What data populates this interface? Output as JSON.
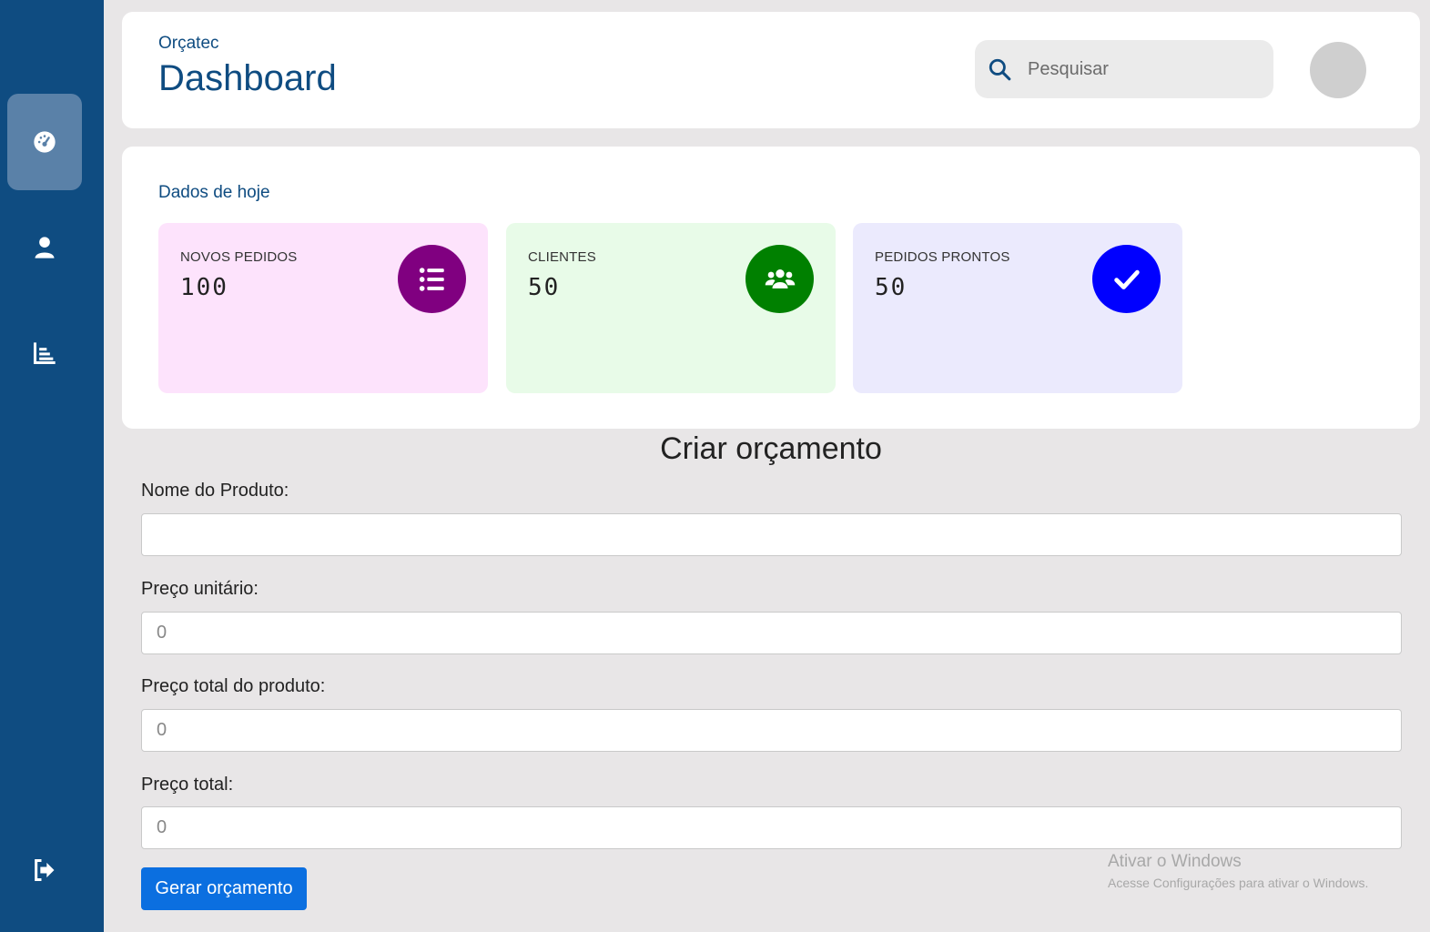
{
  "header": {
    "brand": "Orçatec",
    "title": "Dashboard",
    "search_placeholder": "Pesquisar"
  },
  "sidebar": {
    "items": [
      {
        "icon": "gauge-icon",
        "active": true
      },
      {
        "icon": "user-icon",
        "active": false
      },
      {
        "icon": "bar-chart-icon",
        "active": false
      },
      {
        "icon": "logout-icon",
        "active": false
      }
    ]
  },
  "stats": {
    "title": "Dados de hoje",
    "cards": [
      {
        "label": "NOVOS PEDIDOS",
        "value": "100",
        "icon": "list-icon",
        "bg": "#fde3fc",
        "accent": "#800080"
      },
      {
        "label": "CLIENTES",
        "value": "50",
        "icon": "users-icon",
        "bg": "#e8fbe8",
        "accent": "#008000"
      },
      {
        "label": "PEDIDOS PRONTOS",
        "value": "50",
        "icon": "check-icon",
        "bg": "#ebeafd",
        "accent": "#0000ff"
      }
    ]
  },
  "form": {
    "title": "Criar orçamento",
    "fields": [
      {
        "label": "Nome do Produto:",
        "placeholder": ""
      },
      {
        "label": "Preço unitário:",
        "placeholder": "0"
      },
      {
        "label": "Preço total do produto:",
        "placeholder": "0"
      },
      {
        "label": "Preço total:",
        "placeholder": "0"
      }
    ],
    "submit_label": "Gerar orçamento"
  },
  "watermark": {
    "line1": "Ativar o Windows",
    "line2": "Acesse Configurações para ativar o Windows."
  },
  "colors": {
    "sidebar": "#0f4c81",
    "primary_text": "#0f4c81",
    "button": "#0b6fe0"
  }
}
